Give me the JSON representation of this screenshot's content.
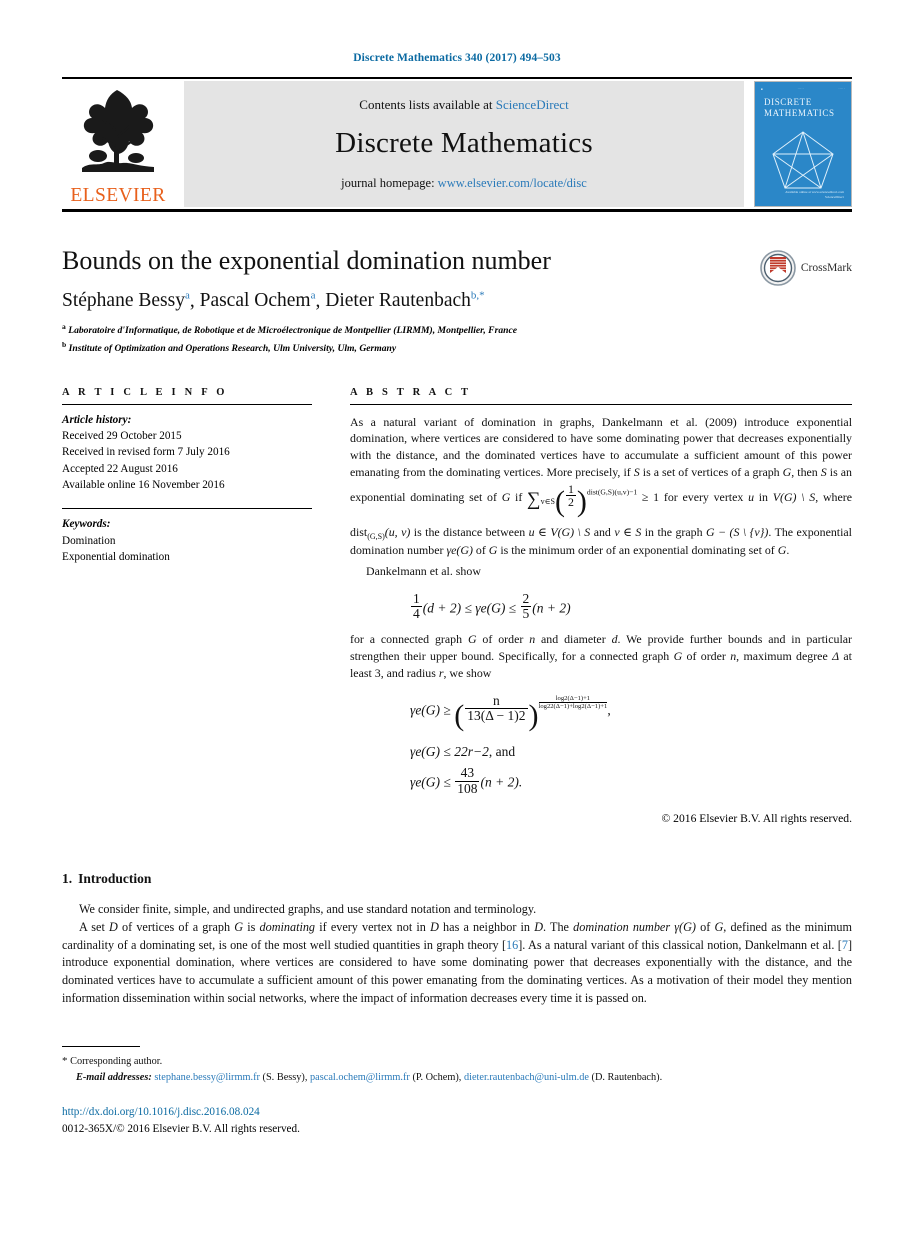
{
  "running_head": "Discrete Mathematics 340 (2017) 494–503",
  "masthead": {
    "publisher_name": "ELSEVIER",
    "contents_prefix": "Contents lists available at",
    "contents_link": "ScienceDirect",
    "journal_name": "Discrete Mathematics",
    "homepage_prefix": "journal homepage:",
    "homepage_link": "www.elsevier.com/locate/disc",
    "cover": {
      "title_line1": "DISCRETE",
      "title_line2": "MATHEMATICS",
      "footer_line1": "Available online at www.sciencedirect.com",
      "footer_line2": "ScienceDirect"
    }
  },
  "article": {
    "title": "Bounds on the exponential domination number",
    "authors": [
      {
        "name": "Stéphane Bessy",
        "mark": "a"
      },
      {
        "name": "Pascal Ochem",
        "mark": "a"
      },
      {
        "name": "Dieter Rautenbach",
        "mark": "b,*"
      }
    ],
    "affiliations": [
      {
        "mark": "a",
        "text": "Laboratoire d'Informatique, de Robotique et de Microélectronique de Montpellier (LIRMM), Montpellier, France"
      },
      {
        "mark": "b",
        "text": "Institute of Optimization and Operations Research, Ulm University, Ulm, Germany"
      }
    ],
    "crossmark_label": "CrossMark"
  },
  "info": {
    "heading": "A R T I C L E  I N F O",
    "history_heading": "Article history:",
    "history": [
      "Received 29 October 2015",
      "Received in revised form 7 July 2016",
      "Accepted 22 August 2016",
      "Available online 16 November 2016"
    ],
    "keywords_heading": "Keywords:",
    "keywords": [
      "Domination",
      "Exponential domination"
    ]
  },
  "abstract": {
    "heading": "A B S T R A C T",
    "para1_a": "As a natural variant of domination in graphs, Dankelmann et al. (2009) introduce exponential domination, where vertices are considered to have some dominating power that decreases exponentially with the distance, and the dominated vertices have to accumulate a sufficient amount of this power emanating from the dominating vertices. More precisely, if ",
    "var_S": "S",
    "para1_b": " is a set of vertices of a graph ",
    "var_G": "G",
    "para1_c": ", then ",
    "para1_d": " is an exponential dominating set of ",
    "para1_e": " if ",
    "sum_sub": "v∈S",
    "sum_base_num": "1",
    "sum_base_den": "2",
    "sum_exp": "dist(G,S)(u,v)−1",
    "para1_f": " ≥ 1 for every vertex ",
    "var_u": "u",
    "para1_g": " in ",
    "set_diff": "V(G) \\ S",
    "para1_h": ", where dist",
    "dist_sub": "(G,S)",
    "dist_args": "(u, v)",
    "para1_i": " is the distance between ",
    "para1_j": " and ",
    "var_v": "v",
    "para1_k": " in the graph ",
    "graph_expr": "G − (S \\ {v})",
    "para1_l": ". The exponential domination number ",
    "gamma_e": "γe(G)",
    "para1_m": " of ",
    "para1_n": " is the minimum order of an exponential dominating set of ",
    "para1_o": ".",
    "para2": "Dankelmann et al. show",
    "equation1": {
      "left_num": "1",
      "left_den": "4",
      "left_tail": "(d + 2) ≤ ",
      "mid": "γe(G)",
      "rel": " ≤ ",
      "right_num": "2",
      "right_den": "5",
      "right_tail": "(n + 2)"
    },
    "para3_a": "for a connected graph ",
    "para3_b": " of order ",
    "var_n": "n",
    "para3_c": " and diameter ",
    "var_d": "d",
    "para3_d": ". We provide further bounds and in particular strengthen their upper bound. Specifically, for a connected graph ",
    "para3_e": " of order ",
    "para3_f": ", maximum degree ",
    "var_Delta": "Δ",
    "para3_g": " at least 3, and radius ",
    "var_r": "r",
    "para3_h": ", we show",
    "equation2": {
      "lhs": "γe(G)",
      "rel": " ≥ ",
      "frac_num": "n",
      "frac_den": "13(Δ − 1)2",
      "exp_num": "log2(Δ−1)+1",
      "exp_den": "log22(Δ−1)+log2(Δ−1)+1",
      "tail": ","
    },
    "equation3": {
      "lhs": "γe(G)",
      "rel": " ≤ ",
      "rhs": "22r−2",
      "tail": ", and"
    },
    "equation4": {
      "lhs": "γe(G)",
      "rel": " ≤ ",
      "num": "43",
      "den": "108",
      "tail": "(n + 2)."
    },
    "copyright": "© 2016 Elsevier B.V. All rights reserved."
  },
  "body": {
    "section_number": "1.",
    "section_title": "Introduction",
    "para1": "We consider finite, simple, and undirected graphs, and use standard notation and terminology.",
    "para2_a": "A set ",
    "var_D": "D",
    "para2_b": " of vertices of a graph ",
    "var_G": "G",
    "para2_c": " is ",
    "em_dominating": "dominating",
    "para2_d": " if every vertex not in ",
    "para2_e": " has a neighbor in ",
    "para2_f": ". The ",
    "em_domnum": "domination number",
    "para2_g": " γ(G)",
    "para2_h": " of ",
    "para2_i": ", defined as the minimum cardinality of a dominating set, is one of the most well studied quantities in graph theory [",
    "cite16": "16",
    "para2_j": "]. As a natural variant of this classical notion, Dankelmann et al. [",
    "cite7": "7",
    "para2_k": "] introduce exponential domination, where vertices are considered to have some dominating power that decreases exponentially with the distance, and the dominated vertices have to accumulate a sufficient amount of this power emanating from the dominating vertices. As a motivation of their model they mention information dissemination within social networks, where the impact of information decreases every time it is passed on."
  },
  "footnotes": {
    "corresponding_star": "*",
    "corresponding_text": "Corresponding author.",
    "email_label": "E-mail addresses:",
    "emails": [
      {
        "address": "stephane.bessy@lirmm.fr",
        "person": "(S. Bessy)"
      },
      {
        "address": "pascal.ochem@lirmm.fr",
        "person": "(P. Ochem)"
      },
      {
        "address": "dieter.rautenbach@uni-ulm.de",
        "person": "(D. Rautenbach)"
      }
    ],
    "doi": "http://dx.doi.org/10.1016/j.disc.2016.08.024",
    "issn_line": "0012-365X/© 2016 Elsevier B.V. All rights reserved."
  },
  "colors": {
    "link": "#2a7ab9",
    "runhead": "#0b6aa2",
    "elsevier_orange": "#E8601C",
    "cover_blue": "#2b87c8"
  }
}
